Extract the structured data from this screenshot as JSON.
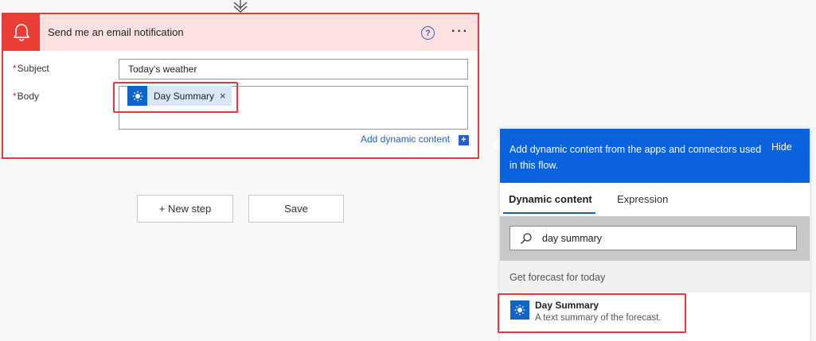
{
  "action_card": {
    "title": "Send me an email notification",
    "icon": "bell-icon",
    "accent_color": "#eb3c35",
    "help_glyph": "?",
    "more_glyph": "···",
    "fields": {
      "subject_label": "Subject",
      "subject_value": "Today's weather",
      "body_label": "Body",
      "required_mark": "*"
    },
    "body_token": {
      "label": "Day Summary",
      "icon": "sun-icon",
      "remove_glyph": "×"
    },
    "add_dynamic_label": "Add dynamic content",
    "add_dynamic_glyph": "+"
  },
  "actions": {
    "new_step_label": "+ New step",
    "save_label": "Save"
  },
  "dynamic_panel": {
    "header_text": "Add dynamic content from the apps and connectors used in this flow.",
    "hide_label": "Hide",
    "header_color": "#0a62dd",
    "tabs": [
      {
        "label": "Dynamic content",
        "active": true
      },
      {
        "label": "Expression",
        "active": false
      }
    ],
    "search_value": "day summary",
    "group_label": "Get forecast for today",
    "results": [
      {
        "title": "Day Summary",
        "description": "A text summary of the forecast.",
        "icon": "sun-icon"
      }
    ]
  }
}
